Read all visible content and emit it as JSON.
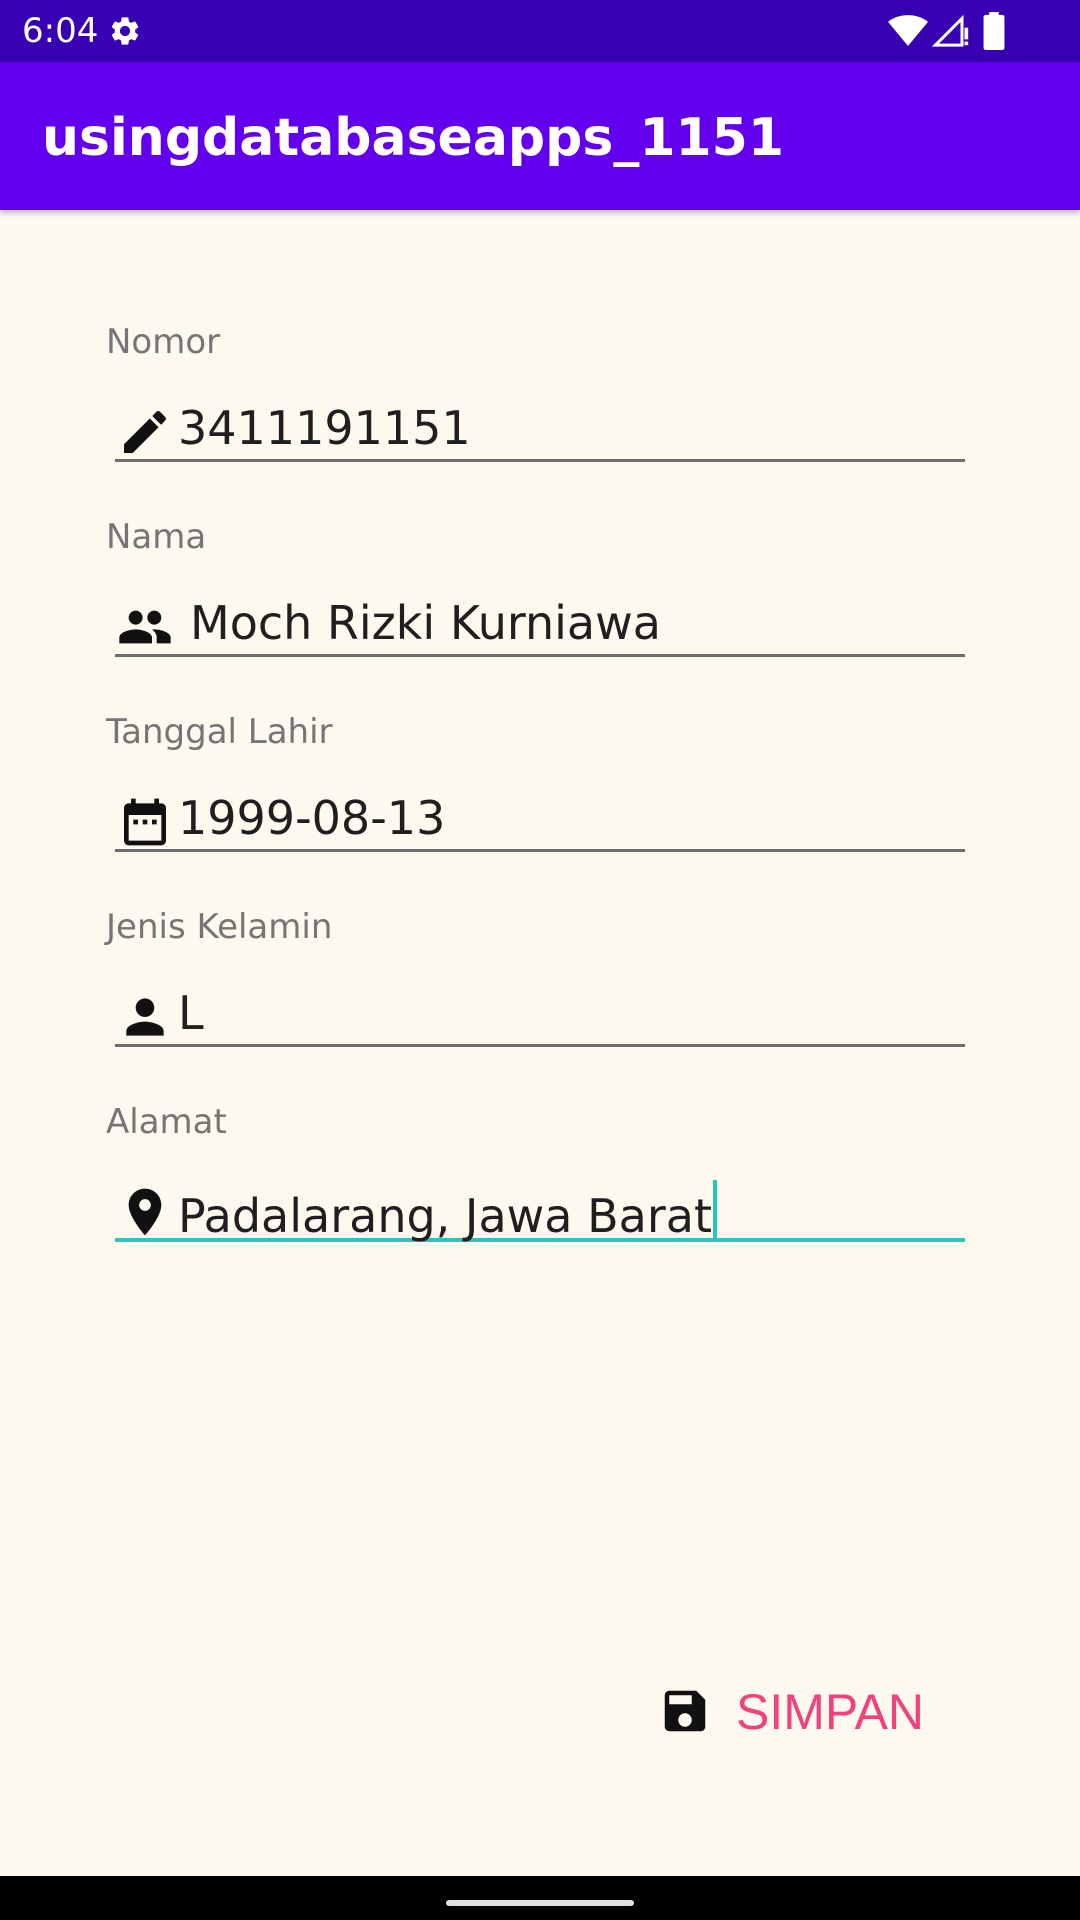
{
  "status_bar": {
    "time": "6:04",
    "icons": [
      "gear-icon",
      "wifi-icon",
      "signal-icon",
      "battery-icon"
    ]
  },
  "app_bar": {
    "title": "usingdatabaseapps_1151"
  },
  "form": {
    "fields": [
      {
        "label": "Nomor",
        "value": "3411191151",
        "icon": "edit-icon"
      },
      {
        "label": "Nama",
        "value": "Moch Rizki Kurniawa",
        "icon": "people-icon"
      },
      {
        "label": "Tanggal Lahir",
        "value": "1999-08-13",
        "icon": "calendar-icon"
      },
      {
        "label": "Jenis Kelamin",
        "value": "L",
        "icon": "person-icon"
      },
      {
        "label": "Alamat",
        "value": "Padalarang, Jawa Barat",
        "icon": "location-icon",
        "focused": true
      }
    ]
  },
  "save_button": {
    "label": "SIMPAN",
    "icon": "save-icon"
  },
  "colors": {
    "status_bar": "#3700B3",
    "app_bar": "#6200EE",
    "background": "#FDF9EF",
    "accent_focus": "#26C6BE",
    "button_text": "#F0437D"
  }
}
